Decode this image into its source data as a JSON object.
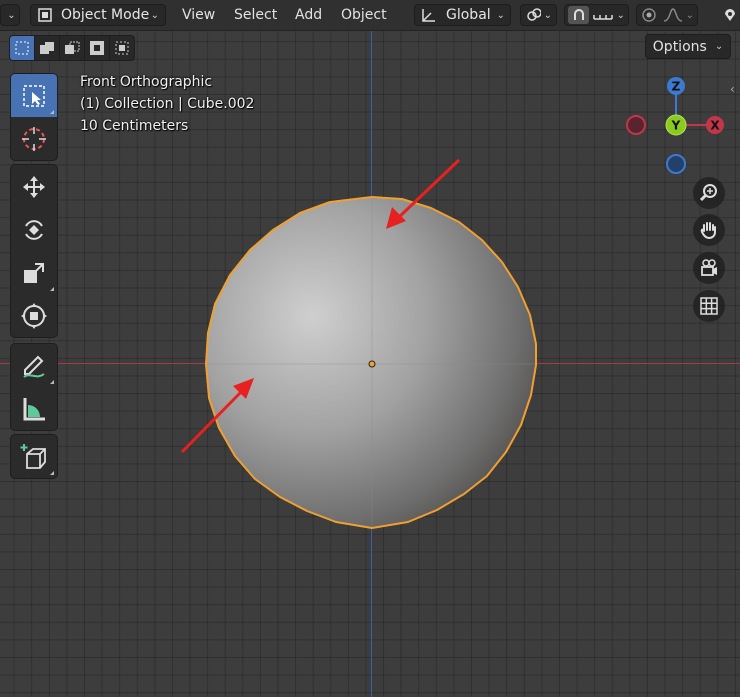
{
  "header": {
    "mode_label": "Object Mode",
    "menus": [
      "View",
      "Select",
      "Add",
      "Object"
    ],
    "transform_orientation": "Global"
  },
  "subbar": {
    "options_label": "Options"
  },
  "viewport": {
    "view_name": "Front Orthographic",
    "collection_info": "(1) Collection | Cube.002",
    "grid_scale": "10 Centimeters"
  },
  "gizmo": {
    "z_label": "Z",
    "y_label": "Y",
    "x_label": "X"
  },
  "toolbar": {
    "tools": [
      "select-box",
      "cursor",
      "move",
      "rotate",
      "scale",
      "transform",
      "annotate",
      "measure",
      "add-cube"
    ]
  },
  "colors": {
    "viewport_bg": "#3d3d3d",
    "header_bg": "#303030",
    "active_blue": "#4772b3",
    "selection_outline": "#f0a030",
    "annotation_arrow": "#e82020",
    "axis_x": "#c2364a",
    "axis_y": "#8bcb1e",
    "axis_z": "#3b7ad0"
  }
}
